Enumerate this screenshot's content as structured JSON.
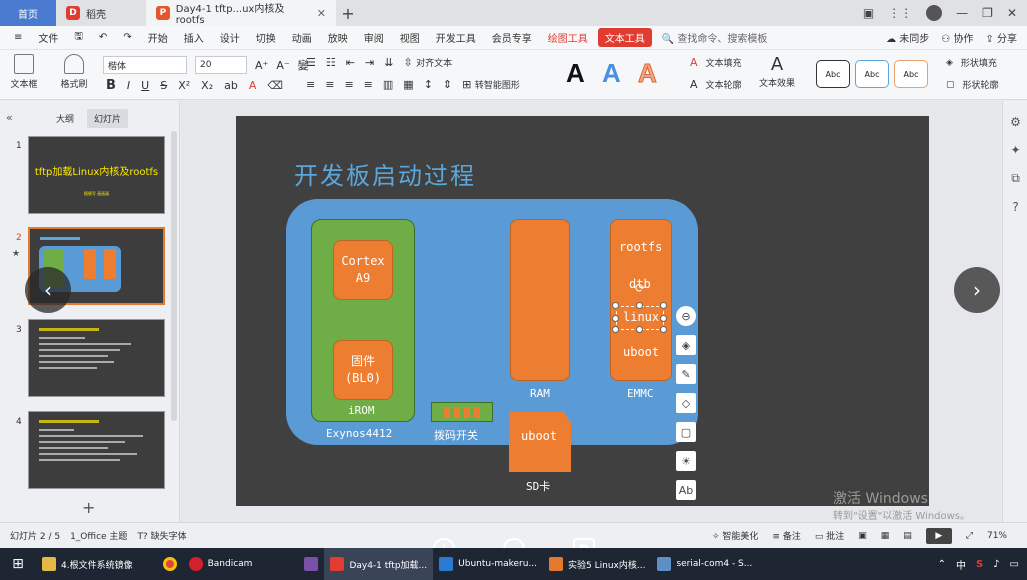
{
  "tabs": {
    "home": "首页",
    "board": "稻壳",
    "doc": "Day4-1 tftp...ux内核及rootfs"
  },
  "menu": {
    "file": "文件",
    "items": [
      "开始",
      "插入",
      "设计",
      "切换",
      "动画",
      "放映",
      "审阅",
      "视图",
      "开发工具",
      "会员专享"
    ],
    "drawing_tools": "绘图工具",
    "text_tools": "文本工具",
    "search": "查找命令、搜索模板",
    "sync": "未同步",
    "collab": "协作",
    "share": "分享"
  },
  "ribbon": {
    "textbox": "文本框",
    "format_painter": "格式刷",
    "font": "楷体",
    "size": "20",
    "align_text": "对齐文本",
    "smart_shape": "转智能图形",
    "text_fill": "文本填充",
    "text_outline": "文本轮廓",
    "text_effect": "文本效果",
    "shape_fill": "形状填充",
    "shape_outline": "形状轮廓",
    "abc": "Abc"
  },
  "sidebar": {
    "tab_outline": "大纲",
    "tab_slides": "幻灯片",
    "thumbs": [
      {
        "num": "1",
        "title": "tftp加载Linux内核及rootfs",
        "sub": "随便写 画画画"
      },
      {
        "num": "2"
      },
      {
        "num": "3"
      },
      {
        "num": "4"
      }
    ]
  },
  "slide": {
    "title": "开发板启动过程",
    "cortex": "Cortex\nA9",
    "bl0": "固件\n(BL0)",
    "irom": "iROM",
    "exynos": "Exynos4412",
    "dip": "拨码开关",
    "ram": "RAM",
    "rootfs": "rootfs",
    "dtb": "dtb",
    "linux": "linux",
    "uboot": "uboot",
    "emmc": "EMMC",
    "sd_uboot": "uboot",
    "sd": "SD卡"
  },
  "watermark": {
    "line1": "激活 Windows",
    "line2": "转到\"设置\"以激活 Windows。"
  },
  "status": {
    "slide": "幻灯片 2 / 5",
    "theme": "1_Office 主题",
    "missing_font": "缺失字体",
    "smart": "智能美化",
    "notes": "备注",
    "comment": "批注",
    "zoom": "71%"
  },
  "taskbar": {
    "items": [
      "4.根文件系统镜像",
      "",
      "Bandicam",
      "",
      "Day4-1 tftp加载...",
      "Ubuntu-makeru...",
      "实验5 Linux内核...",
      "serial-com4 - S..."
    ],
    "ime": "中"
  },
  "colors": {
    "board": "#5b9bd5",
    "green": "#6fad47",
    "orange": "#ed7d31",
    "title": "#5aa7dd",
    "accent": "#e03c31"
  }
}
